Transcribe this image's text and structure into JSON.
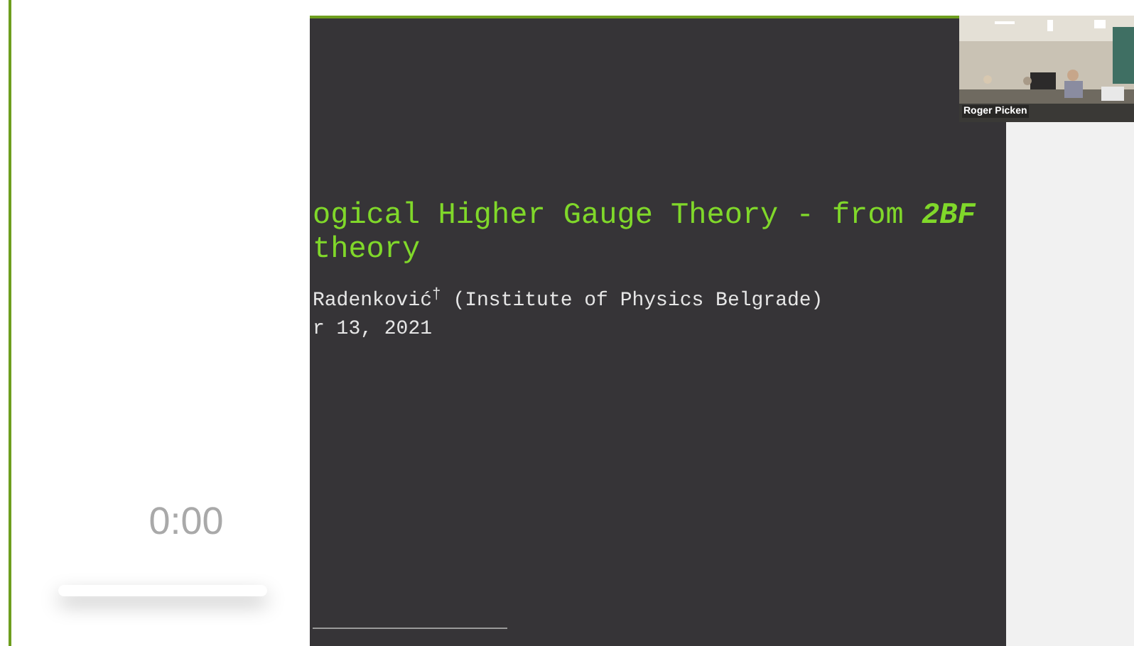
{
  "player": {
    "time": "0:00",
    "level": 0
  },
  "slide": {
    "title_lines": [
      "ogical Higher Gauge Theory - from *2BF*",
      "theory"
    ],
    "author": "Radenković$^{†}$ (Institute of Physics Belgrade)",
    "date": "r 13, 2021"
  },
  "video": {
    "participant_name": "Roger Picken"
  }
}
